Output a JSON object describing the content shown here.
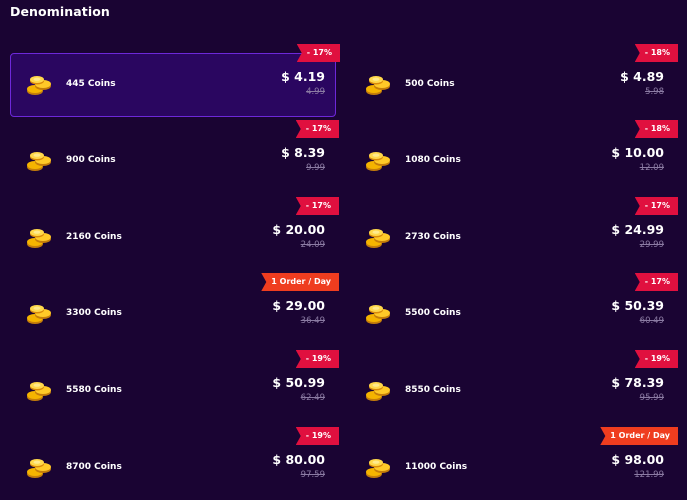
{
  "header": {
    "title": "Denomination"
  },
  "colors": {
    "background": "#1a0433",
    "selected": "#2a0660",
    "discount_tag": "#e0103f",
    "limit_tag": "#ef3d1f"
  },
  "items": [
    {
      "name": "445 Coins",
      "price": "$ 4.19",
      "original": "4.99",
      "tag": "- 17%",
      "tag_kind": "discount",
      "selected": true
    },
    {
      "name": "500 Coins",
      "price": "$ 4.89",
      "original": "5.98",
      "tag": "- 18%",
      "tag_kind": "discount",
      "selected": false
    },
    {
      "name": "900 Coins",
      "price": "$ 8.39",
      "original": "9.99",
      "tag": "- 17%",
      "tag_kind": "discount",
      "selected": false
    },
    {
      "name": "1080 Coins",
      "price": "$ 10.00",
      "original": "12.09",
      "tag": "- 18%",
      "tag_kind": "discount",
      "selected": false
    },
    {
      "name": "2160 Coins",
      "price": "$ 20.00",
      "original": "24.09",
      "tag": "- 17%",
      "tag_kind": "discount",
      "selected": false
    },
    {
      "name": "2730 Coins",
      "price": "$ 24.99",
      "original": "29.99",
      "tag": "- 17%",
      "tag_kind": "discount",
      "selected": false
    },
    {
      "name": "3300 Coins",
      "price": "$ 29.00",
      "original": "36.49",
      "tag": "1 Order / Day",
      "tag_kind": "limit",
      "selected": false
    },
    {
      "name": "5500 Coins",
      "price": "$ 50.39",
      "original": "60.49",
      "tag": "- 17%",
      "tag_kind": "discount",
      "selected": false
    },
    {
      "name": "5580 Coins",
      "price": "$ 50.99",
      "original": "62.49",
      "tag": "- 19%",
      "tag_kind": "discount",
      "selected": false
    },
    {
      "name": "8550 Coins",
      "price": "$ 78.39",
      "original": "95.99",
      "tag": "- 19%",
      "tag_kind": "discount",
      "selected": false
    },
    {
      "name": "8700 Coins",
      "price": "$ 80.00",
      "original": "97.59",
      "tag": "- 19%",
      "tag_kind": "discount",
      "selected": false
    },
    {
      "name": "11000 Coins",
      "price": "$ 98.00",
      "original": "121.99",
      "tag": "1 Order / Day",
      "tag_kind": "limit",
      "selected": false
    }
  ]
}
